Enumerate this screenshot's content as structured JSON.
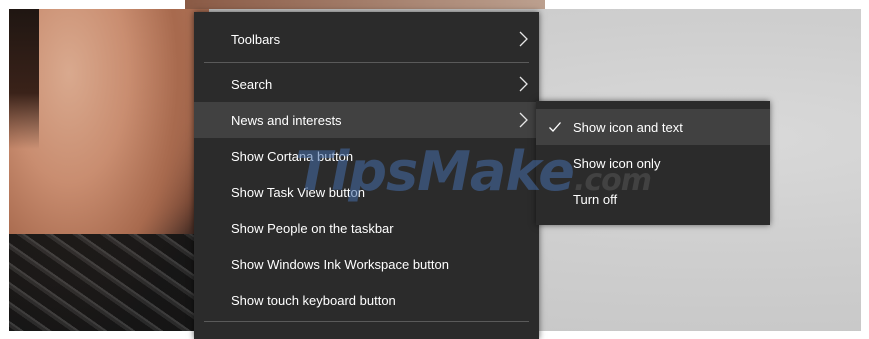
{
  "context_menu": {
    "items": [
      {
        "label": "Toolbars",
        "has_submenu": true
      },
      {
        "label": "Search",
        "has_submenu": true
      },
      {
        "label": "News and interests",
        "has_submenu": true
      },
      {
        "label": "Show Cortana button",
        "has_submenu": false
      },
      {
        "label": "Show Task View button",
        "has_submenu": false
      },
      {
        "label": "Show People on the taskbar",
        "has_submenu": false
      },
      {
        "label": "Show Windows Ink Workspace button",
        "has_submenu": false
      },
      {
        "label": "Show touch keyboard button",
        "has_submenu": false
      }
    ],
    "active_item": "News and interests"
  },
  "news_submenu": {
    "items": [
      {
        "label": "Show icon and text",
        "checked": true
      },
      {
        "label": "Show icon only",
        "checked": false
      },
      {
        "label": "Turn off",
        "checked": false
      }
    ]
  },
  "watermark": {
    "text": "TipsMake",
    "suffix": ".com"
  },
  "colors": {
    "menu_bg": "#2b2b2b",
    "menu_hover": "#414141",
    "menu_text": "#ffffff",
    "separator": "#5a5a5a"
  },
  "icons": {
    "submenu_arrow": "chevron-right-icon",
    "check": "check-icon"
  }
}
